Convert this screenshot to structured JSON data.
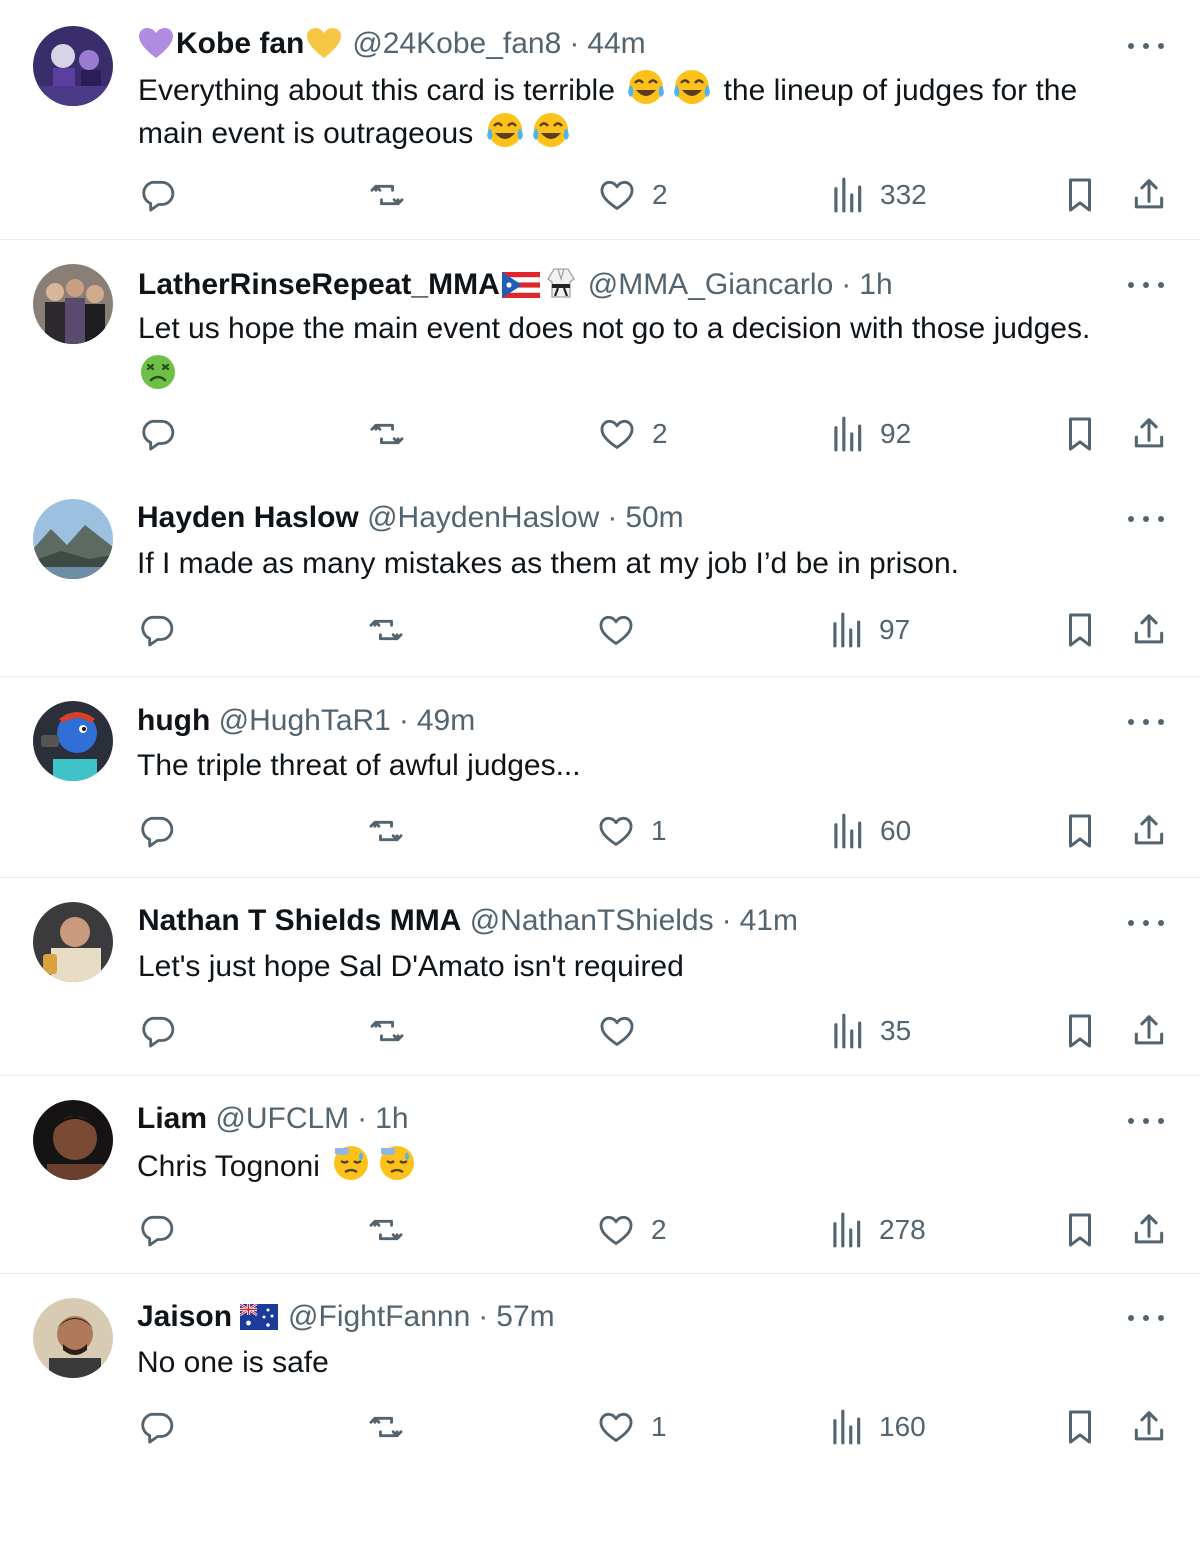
{
  "tweets": [
    {
      "name": "Kobe fan",
      "handle": "@24Kobe_fan8",
      "separator": "·",
      "time": "44m",
      "text_line1_a": "Everything about this card is terrible",
      "text_line1_b": "the lineup of judges for the",
      "text_line2": "main event is outrageous",
      "name_decorations": [
        "purple-heart",
        "yellow-heart"
      ],
      "text_emojis": [
        "face-with-tears-of-joy",
        "face-with-tears-of-joy",
        "face-with-tears-of-joy",
        "face-with-tears-of-joy"
      ],
      "likes": "2",
      "views": "332"
    },
    {
      "name": "LatherRinseRepeat_MMA",
      "handle": "@MMA_Giancarlo",
      "separator": "·",
      "time": "1h",
      "text": "Let us hope the main event does not go to a decision with those judges.",
      "name_decorations": [
        "puerto-rico-flag",
        "martial-arts-uniform"
      ],
      "text_emojis": [
        "nauseated-face"
      ],
      "likes": "2",
      "views": "92"
    },
    {
      "name": "Hayden Haslow",
      "handle": "@HaydenHaslow",
      "separator": "·",
      "time": "50m",
      "text": "If I made as many mistakes as them at my job I’d be in prison.",
      "likes": "",
      "views": "97"
    },
    {
      "name": "hugh",
      "handle": "@HughTaR1",
      "separator": "·",
      "time": "49m",
      "text": "The triple threat of awful judges...",
      "likes": "1",
      "views": "60"
    },
    {
      "name": "Nathan T Shields MMA",
      "handle": "@NathanTShields",
      "separator": "·",
      "time": "41m",
      "text": "Let's just hope Sal D'Amato isn't required",
      "likes": "",
      "views": "35"
    },
    {
      "name": "Liam",
      "handle": "@UFCLM",
      "separator": "·",
      "time": "1h",
      "text": "Chris Tognoni",
      "text_emojis": [
        "downcast-face-with-sweat",
        "downcast-face-with-sweat"
      ],
      "likes": "2",
      "views": "278"
    },
    {
      "name": "Jaison",
      "handle": "@FightFannn",
      "separator": "·",
      "time": "57m",
      "text": "No one is safe",
      "name_decorations": [
        "australia-flag"
      ],
      "likes": "1",
      "views": "160"
    }
  ],
  "icons": [
    "reply-icon",
    "retweet-icon",
    "like-icon",
    "views-icon",
    "bookmark-icon",
    "share-icon",
    "more-icon"
  ],
  "colors": {
    "text": "#0f1419",
    "secondary": "#536471",
    "divider": "#e7e9ec"
  }
}
